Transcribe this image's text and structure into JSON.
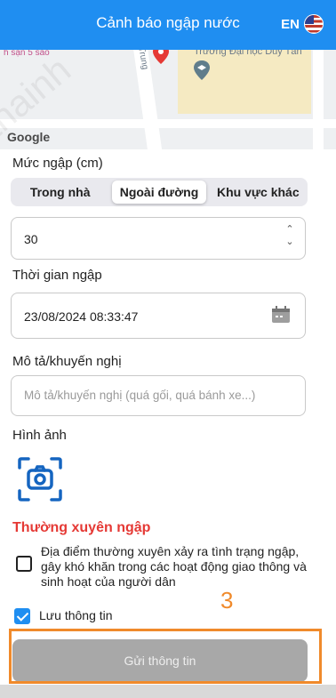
{
  "header": {
    "title": "Cảnh báo ngập nước",
    "lang_label": "EN",
    "lang_flag_icon": "us-flag-icon",
    "color": "#1f8ef1"
  },
  "map": {
    "label_left": "h sạn 5 sao",
    "label_university": "Trường Đại học Duy Tân",
    "street_label": "Trung",
    "google_logo": "Google"
  },
  "flood_level": {
    "label": "Mức ngập (cm)",
    "tabs": [
      {
        "label": "Trong nhà",
        "active": false
      },
      {
        "label": "Ngoài đường",
        "active": true
      },
      {
        "label": "Khu vực khác",
        "active": false
      }
    ],
    "value": "30"
  },
  "flood_time": {
    "label": "Thời gian ngập",
    "value": "23/08/2024 08:33:47"
  },
  "description": {
    "label": "Mô tả/khuyến nghị",
    "placeholder": "Mô tả/khuyến nghị (quá gối, quá bánh xe...)"
  },
  "images": {
    "label": "Hình ảnh"
  },
  "frequent": {
    "title": "Thường xuyên ngập",
    "checkbox_text": "Địa điểm thường xuyên xảy ra tình trạng ngập, gây khó khăn trong các hoạt động giao thông và sinh hoạt của người dân",
    "checked": false
  },
  "save_info": {
    "label": "Lưu thông tin",
    "checked": true
  },
  "submit": {
    "label": "Gửi thông tin"
  },
  "annotation": {
    "number": "3",
    "color": "#f08a2b"
  },
  "watermark": "-thainh"
}
